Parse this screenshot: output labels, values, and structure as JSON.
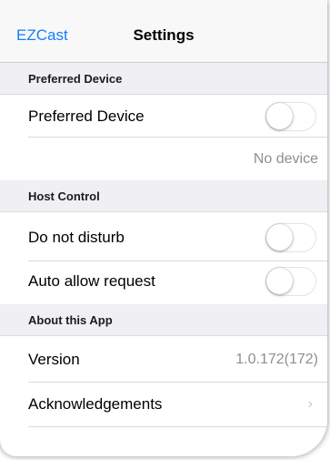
{
  "navbar": {
    "back_label": "EZCast",
    "title": "Settings"
  },
  "sections": {
    "preferred": {
      "header": "Preferred Device"
    },
    "host": {
      "header": "Host Control"
    },
    "about": {
      "header": "About this App"
    }
  },
  "rows": {
    "preferred_device": {
      "label": "Preferred Device",
      "toggle_on": false
    },
    "device_status": {
      "value": "No device"
    },
    "do_not_disturb": {
      "label": "Do not disturb",
      "toggle_on": false
    },
    "auto_allow": {
      "label": "Auto allow request",
      "toggle_on": false
    },
    "version": {
      "label": "Version",
      "value": "1.0.172(172)"
    },
    "acknowledgements": {
      "label": "Acknowledgements",
      "chevron": "chevron-right-icon"
    }
  },
  "colors": {
    "accent": "#157efb",
    "section_bg": "#efeff4",
    "secondary_text": "#8e8e93"
  }
}
